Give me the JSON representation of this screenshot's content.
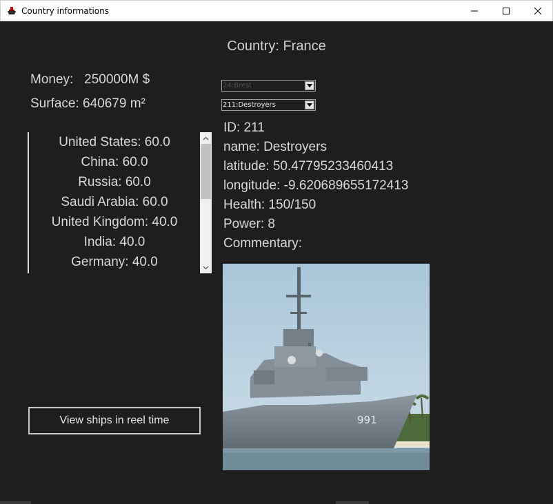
{
  "window": {
    "title": "Country informations",
    "icon": "ship-app-icon"
  },
  "country": {
    "title": "Country: France",
    "money": "Money:   250000M $",
    "surface": "Surface: 640679 m²"
  },
  "relations_list": {
    "items": [
      "United States: 60.0",
      "China: 60.0",
      "Russia: 60.0",
      "Saudi Arabia: 60.0",
      "United Kingdom: 40.0",
      "India: 40.0",
      "Germany: 40.0"
    ]
  },
  "buttons": {
    "realtime": "View ships in reel time"
  },
  "selectors": {
    "port": "24:Brest",
    "ship": "211:Destroyers"
  },
  "ship": {
    "id": "ID: 211",
    "name": "name: Destroyers",
    "latitude": "latitude: 50.47795233460413",
    "longitude": "longitude: -9.620689655172413",
    "health": "Health: 150/150",
    "power": "Power: 8",
    "commentary": "Commentary:",
    "hull_number": "991"
  }
}
